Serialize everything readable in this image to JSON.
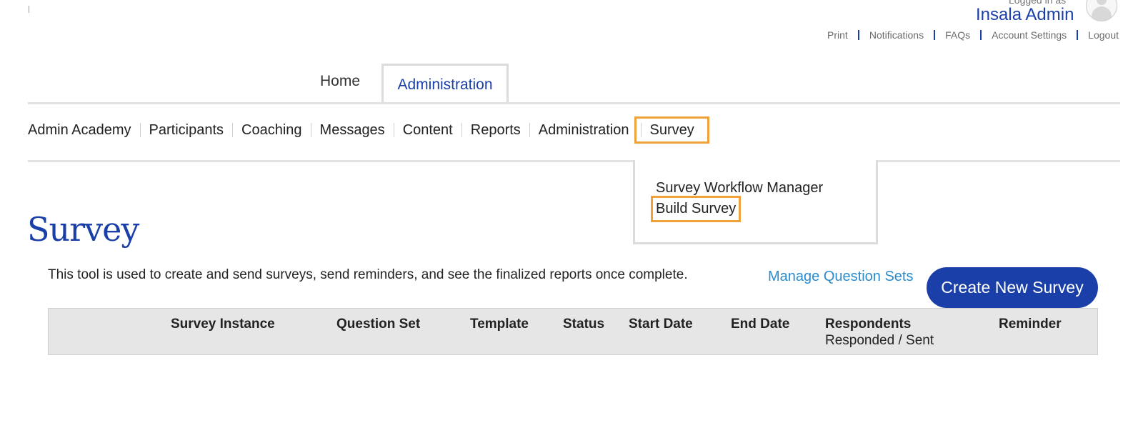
{
  "header": {
    "logged_in_label": "Logged in as",
    "user_name": "Insala Admin",
    "utility_links": [
      "Print",
      "Notifications",
      "FAQs",
      "Account Settings",
      "Logout"
    ]
  },
  "tabs": [
    {
      "label": "Home",
      "active": false
    },
    {
      "label": "Administration",
      "active": true
    }
  ],
  "subnav": [
    "Admin Academy",
    "Participants",
    "Coaching",
    "Messages",
    "Content",
    "Reports",
    "Administration",
    "Survey"
  ],
  "dropdown": [
    "Survey Workflow Manager",
    "Build Survey"
  ],
  "page": {
    "title": "Survey",
    "description": "This tool is used to create and send surveys, send reminders, and see the finalized reports once complete.",
    "manage_link": "Manage Question Sets",
    "create_button": "Create New Survey"
  },
  "table": {
    "columns": [
      "Survey Instance",
      "Question Set",
      "Template",
      "Status",
      "Start Date",
      "End Date",
      "Respondents",
      "Reminder"
    ],
    "respondents_sub": "Responded / Sent"
  },
  "colors": {
    "brand": "#1b3fa8",
    "link": "#2a8ccf",
    "highlight": "#f0a23a"
  }
}
